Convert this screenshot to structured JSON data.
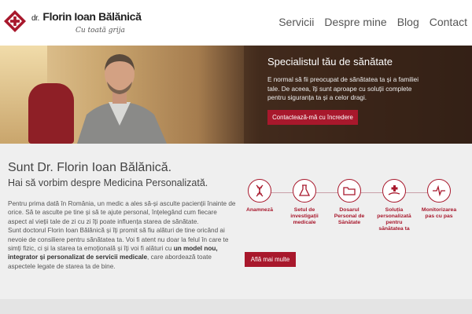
{
  "header": {
    "brand_prefix": "dr.",
    "brand_name": "Florin Ioan Bălănică",
    "tagline": "Cu toată grija"
  },
  "nav": [
    {
      "label": "Servicii"
    },
    {
      "label": "Despre mine"
    },
    {
      "label": "Blog"
    },
    {
      "label": "Contact"
    }
  ],
  "hero": {
    "title": "Specialistul tău de sănătate",
    "text": "E normal să fii preocupat de sănătatea ta și a familiei tale. De aceea, îți sunt aproape cu soluții complete pentru siguranța ta și a celor dragi.",
    "button": "Contactează-mă cu încredere"
  },
  "main": {
    "heading": "Sunt Dr. Florin Ioan Bălănică.",
    "subheading": "Hai să vorbim despre Medicina Personalizată.",
    "p1": "Pentru prima dată în România, un medic a ales să-și asculte pacienții înainte de orice. Să te asculte pe tine și să te ajute personal, înțelegând cum fiecare aspect al vieții tale de zi cu zi îți poate influența starea de sănătate.",
    "p2_start": "Sunt doctorul Florin Ioan Bălănică și îți promit să fiu alături de tine oricând ai nevoie de consiliere pentru sănătatea ta. Voi fi atent nu doar la felul în care te simți fizic, ci și la starea ta emoțională și îți voi fi alături cu ",
    "p2_bold": "un model nou, integrator și personalizat de servicii medicale",
    "p2_end": ", care abordează toate aspectele legate de starea ta de bine.",
    "more_button": "Află mai multe"
  },
  "steps": [
    {
      "label": "Anamneză",
      "icon": "dna-icon"
    },
    {
      "label": "Setul de investigații medicale",
      "icon": "flask-icon"
    },
    {
      "label": "Dosarul Personal de Sănătate",
      "icon": "folder-icon"
    },
    {
      "label": "Soluția personalizată pentru sănătatea ta",
      "icon": "hand-cross-icon"
    },
    {
      "label": "Monitorizarea pas cu pas",
      "icon": "pulse-icon"
    }
  ],
  "colors": {
    "accent": "#a8182c",
    "background": "#efefef"
  }
}
